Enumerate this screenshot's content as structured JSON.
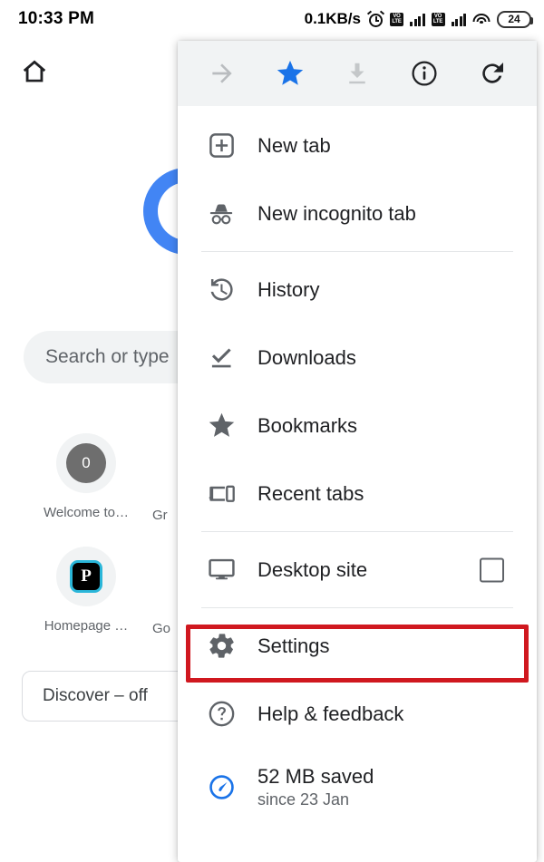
{
  "status_bar": {
    "time": "10:33 PM",
    "network_rate": "0.1KB/s",
    "alarm_icon": "alarm-clock-icon",
    "sim1_label": "VO\nLTE",
    "sim2_label": "VO\nLTE",
    "wifi_icon": "wifi-icon",
    "battery_level": "24"
  },
  "new_tab_page": {
    "home_icon": "home-icon",
    "logo": "google-logo",
    "search": {
      "placeholder": "Search or type",
      "icon": "search-box"
    },
    "tiles": [
      {
        "label": "Welcome to…",
        "icon_text": "0",
        "icon_name": "avatar-circle-icon"
      },
      {
        "label": "Gr",
        "icon_text": "",
        "icon_name": "tile-partial-icon"
      },
      {
        "label": "Homepage …",
        "icon_text": "P",
        "icon_name": "favicon-p-icon"
      },
      {
        "label": "Go",
        "icon_text": "",
        "icon_name": "tile-partial-icon"
      }
    ],
    "discover_chip": "Discover – off"
  },
  "menu": {
    "header_actions": [
      {
        "name": "forward-arrow-icon",
        "label": "Forward",
        "state": "disabled",
        "color": "#b9bcbf"
      },
      {
        "name": "star-icon",
        "label": "Bookmark",
        "state": "active",
        "color": "#1a73e8"
      },
      {
        "name": "download-icon",
        "label": "Download page",
        "state": "disabled",
        "color": "#c4c7c9"
      },
      {
        "name": "info-icon",
        "label": "Page info",
        "state": "enabled",
        "color": "#202124"
      },
      {
        "name": "reload-icon",
        "label": "Reload",
        "state": "enabled",
        "color": "#202124"
      }
    ],
    "items": [
      {
        "label": "New tab",
        "icon": "new-tab-plus-icon"
      },
      {
        "label": "New incognito tab",
        "icon": "incognito-icon"
      },
      {
        "label": "History",
        "icon": "history-clock-icon"
      },
      {
        "label": "Downloads",
        "icon": "downloads-check-icon"
      },
      {
        "label": "Bookmarks",
        "icon": "bookmark-star-icon"
      },
      {
        "label": "Recent tabs",
        "icon": "recent-tabs-devices-icon"
      },
      {
        "label": "Desktop site",
        "icon": "desktop-monitor-icon",
        "checkbox": "unchecked"
      },
      {
        "label": "Settings",
        "icon": "settings-gear-icon",
        "highlighted": true
      },
      {
        "label": "Help & feedback",
        "icon": "help-question-icon"
      },
      {
        "label": "52 MB saved",
        "sublabel": "since 23 Jan",
        "icon": "data-saver-gauge-icon"
      }
    ],
    "highlight_color": "#d0181f"
  }
}
